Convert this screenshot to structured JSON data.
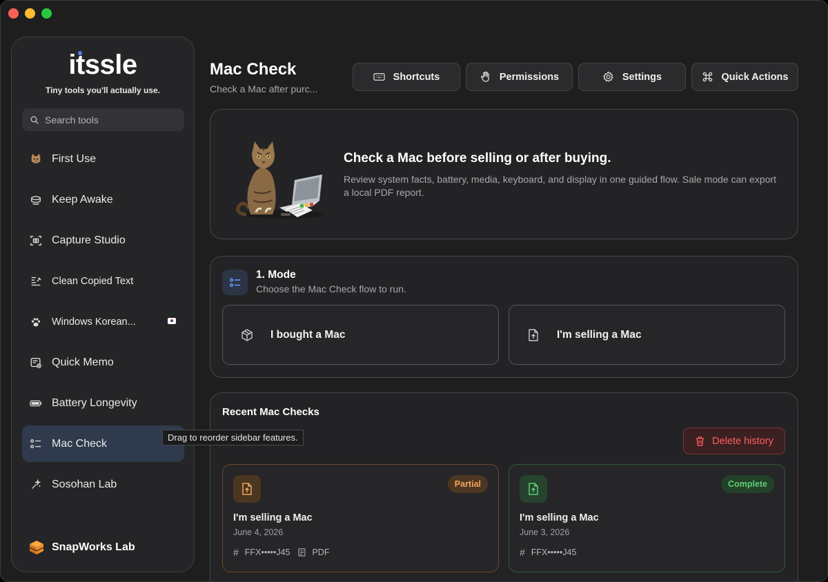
{
  "colors": {
    "accent": "#4f7dff",
    "partial": "#f0a55a",
    "complete": "#5fce74",
    "danger": "#ff5f5f"
  },
  "sidebar": {
    "logo": "itssle",
    "tagline": "Tiny tools you'll actually use.",
    "search_placeholder": "Search tools",
    "items": [
      {
        "label": "First Use",
        "icon": "cat-avatar-icon"
      },
      {
        "label": "Keep Awake",
        "icon": "coffee-cup-icon"
      },
      {
        "label": "Capture Studio",
        "icon": "screenshot-camera-icon"
      },
      {
        "label": "Clean Copied Text",
        "icon": "text-clean-icon"
      },
      {
        "label": "Windows Korean...",
        "icon": "paw-icon",
        "badge": "korean-flag-icon"
      },
      {
        "label": "Quick Memo",
        "icon": "memo-icon"
      },
      {
        "label": "Battery Longevity",
        "icon": "battery-icon"
      },
      {
        "label": "Mac Check",
        "icon": "checklist-icon",
        "active": true
      },
      {
        "label": "Sosohan Lab",
        "icon": "sparkles-icon"
      }
    ],
    "brand": "SnapWorks Lab",
    "tooltip": "Drag to reorder sidebar features."
  },
  "header": {
    "title": "Mac Check",
    "subtitle": "Check a Mac after purc...",
    "buttons": [
      {
        "label": "Shortcuts",
        "icon": "keyboard-icon"
      },
      {
        "label": "Permissions",
        "icon": "hand-icon"
      },
      {
        "label": "Settings",
        "icon": "gear-icon"
      },
      {
        "label": "Quick Actions",
        "icon": "command-icon"
      }
    ]
  },
  "hero": {
    "title": "Check a Mac before selling or after buying.",
    "description": "Review system facts, battery, media, keyboard, and display in one guided flow. Sale mode can export a local PDF report."
  },
  "mode": {
    "title": "1. Mode",
    "subtitle": "Choose the Mac Check flow to run.",
    "options": [
      {
        "label": "I bought a Mac",
        "icon": "box-icon"
      },
      {
        "label": "I'm selling a Mac",
        "icon": "document-upload-icon"
      }
    ]
  },
  "recent": {
    "title": "Recent Mac Checks",
    "delete_label": "Delete history",
    "items": [
      {
        "title": "I'm selling a Mac",
        "date": "June 4, 2026",
        "status": "Partial",
        "serial": "FFX•••••J45",
        "file": "PDF"
      },
      {
        "title": "I'm selling a Mac",
        "date": "June 3, 2026",
        "status": "Complete",
        "serial": "FFX•••••J45"
      }
    ]
  }
}
